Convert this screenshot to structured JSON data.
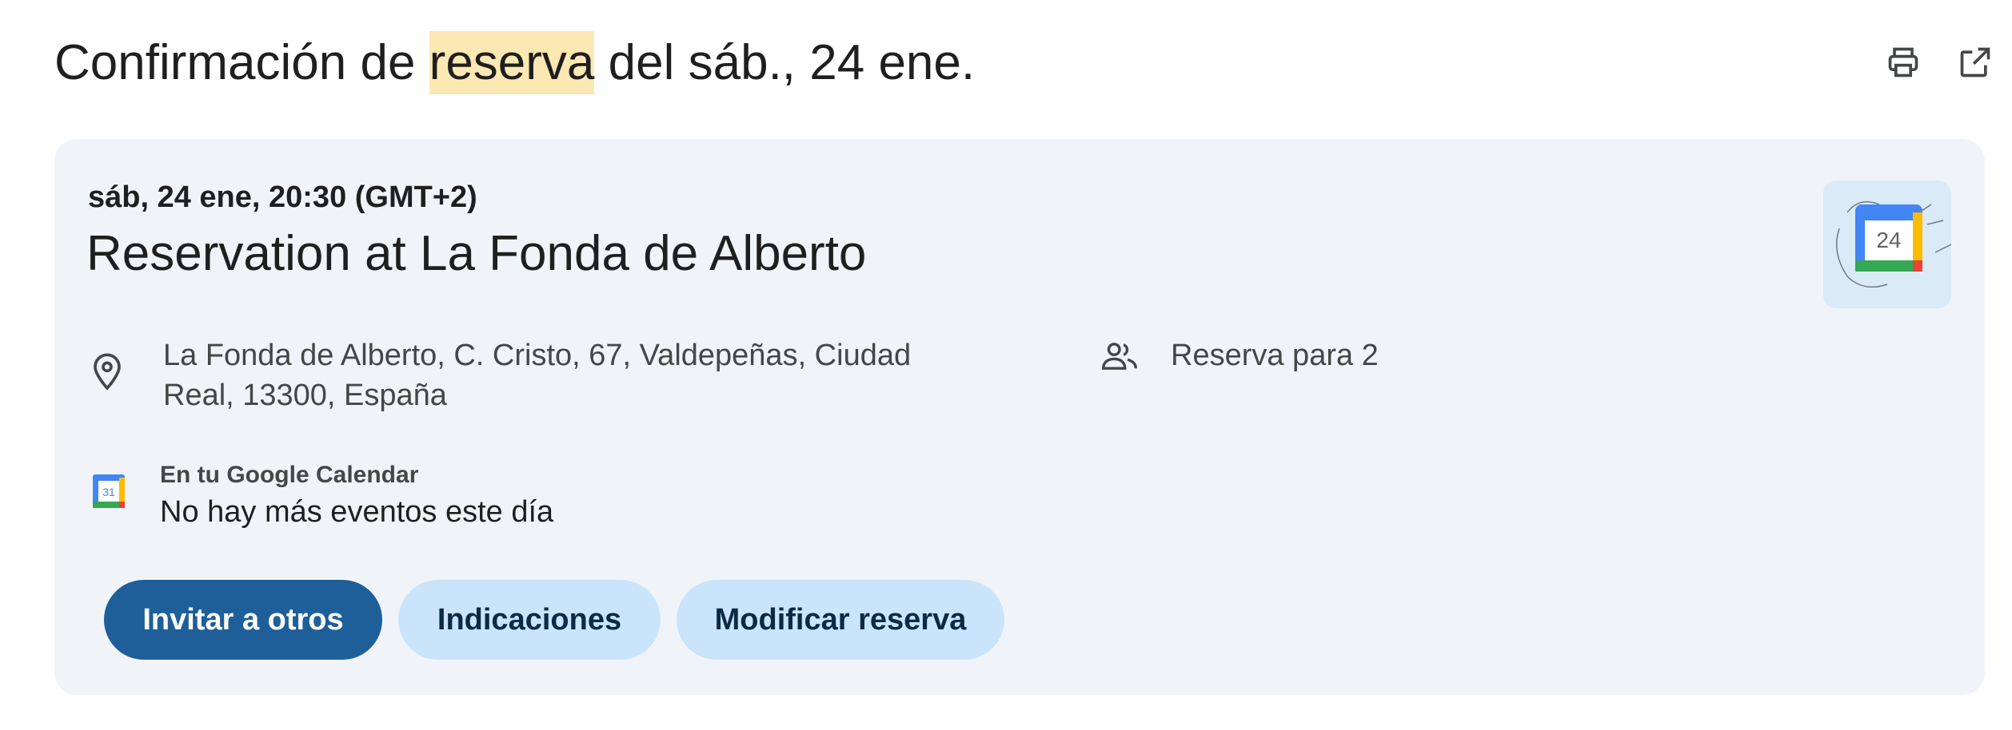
{
  "subject": {
    "before": "Confirmación de ",
    "highlight": "reserva",
    "after": " del sáb., 24 ene."
  },
  "toolbar": {
    "print_icon": "print-icon",
    "open_in_new_icon": "open-in-new-window-icon"
  },
  "event": {
    "time": "sáb, 24 ene, 20:30 (GMT+2)",
    "title": "Reservation at La Fonda de Alberto",
    "calendar_art_day": "24"
  },
  "location": {
    "icon": "location-pin-icon",
    "address": "La Fonda de Alberto, C. Cristo, 67, Valdepeñas, Ciudad Real, 13300, España"
  },
  "guests": {
    "icon": "people-icon",
    "text": "Reserva para 2"
  },
  "calendar": {
    "icon": "google-calendar-icon",
    "icon_day": "31",
    "label": "En tu Google Calendar",
    "status": "No hay más eventos este día"
  },
  "buttons": {
    "invite": "Invitar a otros",
    "directions": "Indicaciones",
    "modify": "Modificar reserva"
  },
  "colors": {
    "highlight": "#fce8b2",
    "card_bg": "#f0f4f9",
    "primary_button": "#1f5f99",
    "secondary_button": "#c9e4fb"
  }
}
